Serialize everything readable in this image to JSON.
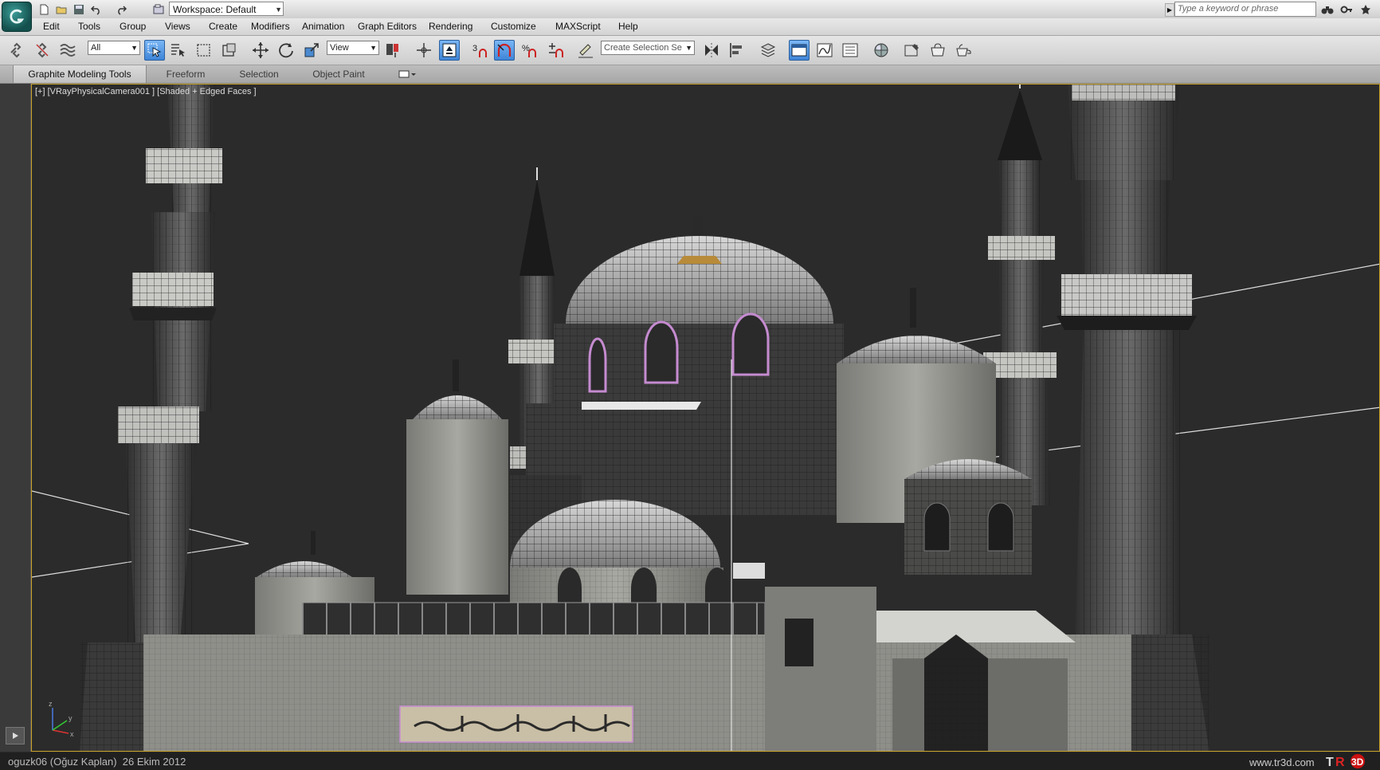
{
  "titlebar": {
    "workspace_label": "Workspace: Default",
    "search_placeholder": "Type a keyword or phrase",
    "quick_access": [
      "new-file-icon",
      "open-folder-icon",
      "save-icon",
      "undo-icon",
      "redo-icon",
      "project-folder-icon"
    ],
    "right_icons": [
      "binoculars-icon",
      "key-icon",
      "star-icon"
    ]
  },
  "menu": {
    "items": [
      "Edit",
      "Tools",
      "Group",
      "Views",
      "Create",
      "Modifiers",
      "Animation",
      "Graph Editors",
      "Rendering",
      "Customize",
      "MAXScript",
      "Help"
    ]
  },
  "toolbar": {
    "selection_filter": "All",
    "reference_coord": "View",
    "named_selection_placeholder": "Create Selection Se",
    "snap_label": "3",
    "percent_snap_label": "%"
  },
  "ribbon": {
    "tabs": [
      "Graphite Modeling Tools",
      "Freeform",
      "Selection",
      "Object Paint"
    ],
    "active_tab": "Graphite Modeling Tools"
  },
  "viewport": {
    "label": "[+] [VRayPhysicalCamera001 ] [Shaded + Edged Faces ]",
    "border_color": "#c9a227",
    "background": "#2b2b2b",
    "axes": {
      "x": "x",
      "y": "y",
      "z": "z"
    }
  },
  "status": {
    "text": "oguzk06 (Oğuz Kaplan)  26 Ekim 2012",
    "watermark_url": "www.tr3d.com",
    "watermark_logo_left": "T",
    "watermark_logo_mid": "R",
    "watermark_logo_right": "3D"
  }
}
